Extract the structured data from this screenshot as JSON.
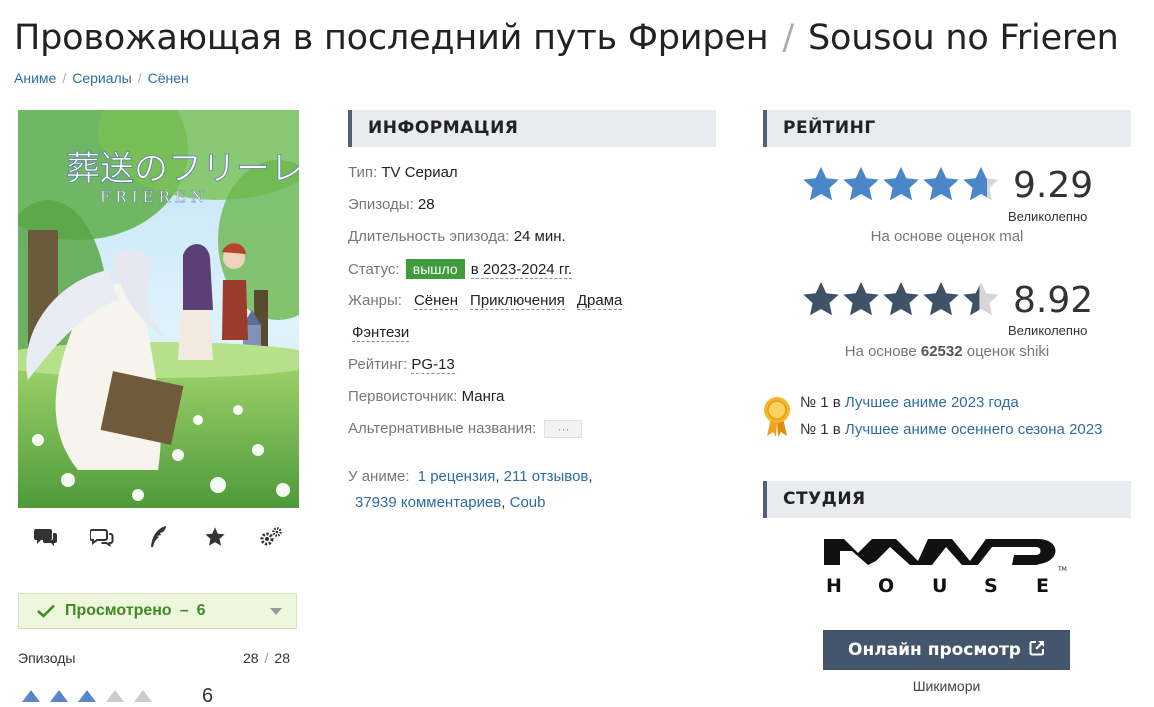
{
  "title": {
    "ru": "Провожающая в последний путь Фрирен",
    "separator": "/",
    "romaji": "Sousou no Frieren"
  },
  "breadcrumbs": [
    "Аниме",
    "Сериалы",
    "Сёнен"
  ],
  "poster": {
    "title_jp": "葬送のフリーレン",
    "title_en": "FRIEREN"
  },
  "toolbar": [
    "comments-icon",
    "discussion-icon",
    "review-icon",
    "favorite-icon",
    "settings-icon"
  ],
  "watched": {
    "label": "Просмотрено",
    "dash": "–",
    "score": "6"
  },
  "episodes": {
    "label": "Эпизоды",
    "watched": "28",
    "slash": "/",
    "total": "28"
  },
  "user_rating_stub": {
    "filled": 3,
    "total": 5,
    "partial_text": "6"
  },
  "info": {
    "header": "ИНФОРМАЦИЯ",
    "type_label": "Тип:",
    "type_value": "TV Сериал",
    "episodes_label": "Эпизоды:",
    "episodes_value": "28",
    "duration_label": "Длительность эпизода:",
    "duration_value": "24 мин.",
    "status_label": "Статус:",
    "status_badge": "вышло",
    "status_dates": "в 2023-2024 гг.",
    "genres_label": "Жанры:",
    "genres": [
      "Сёнен",
      "Приключения",
      "Драма",
      "Фэнтези"
    ],
    "rating_label": "Рейтинг:",
    "rating_value": "PG-13",
    "source_label": "Первоисточник:",
    "source_value": "Манга",
    "alt_label": "Альтернативные названия:",
    "alt_button": "···",
    "about_label": "У аниме:",
    "about_links": [
      "1 рецензия",
      "211 отзывов",
      "37939 комментариев",
      "Coub"
    ]
  },
  "rating": {
    "header": "РЕЙТИНГ",
    "mal": {
      "score": "9.29",
      "word": "Великолепно",
      "basis": "На основе оценок mal",
      "stars": 4.65,
      "color": "#4a86c8"
    },
    "shiki": {
      "score": "8.92",
      "word": "Великолепно",
      "basis_prefix": "На основе",
      "basis_count": "62532",
      "basis_suffix": "оценок shiki",
      "stars": 4.46,
      "color": "#3d5266"
    }
  },
  "awards": [
    {
      "prefix": "№ 1 в",
      "link": "Лучшее аниме 2023 года"
    },
    {
      "prefix": "№ 1 в",
      "link": "Лучшее аниме осеннего сезона 2023"
    }
  ],
  "studio": {
    "header": "СТУДИЯ",
    "logo_top": "MAPPA",
    "logo_bottom": "HOUSE"
  },
  "online": {
    "button": "Онлайн просмотр",
    "source": "Шикимори"
  },
  "colors": {
    "accent": "#2e6da4",
    "header_bg": "#e8ebef",
    "badge": "#3f9b3c",
    "watched_bg": "#eef6de",
    "button_bg": "#43566c"
  }
}
